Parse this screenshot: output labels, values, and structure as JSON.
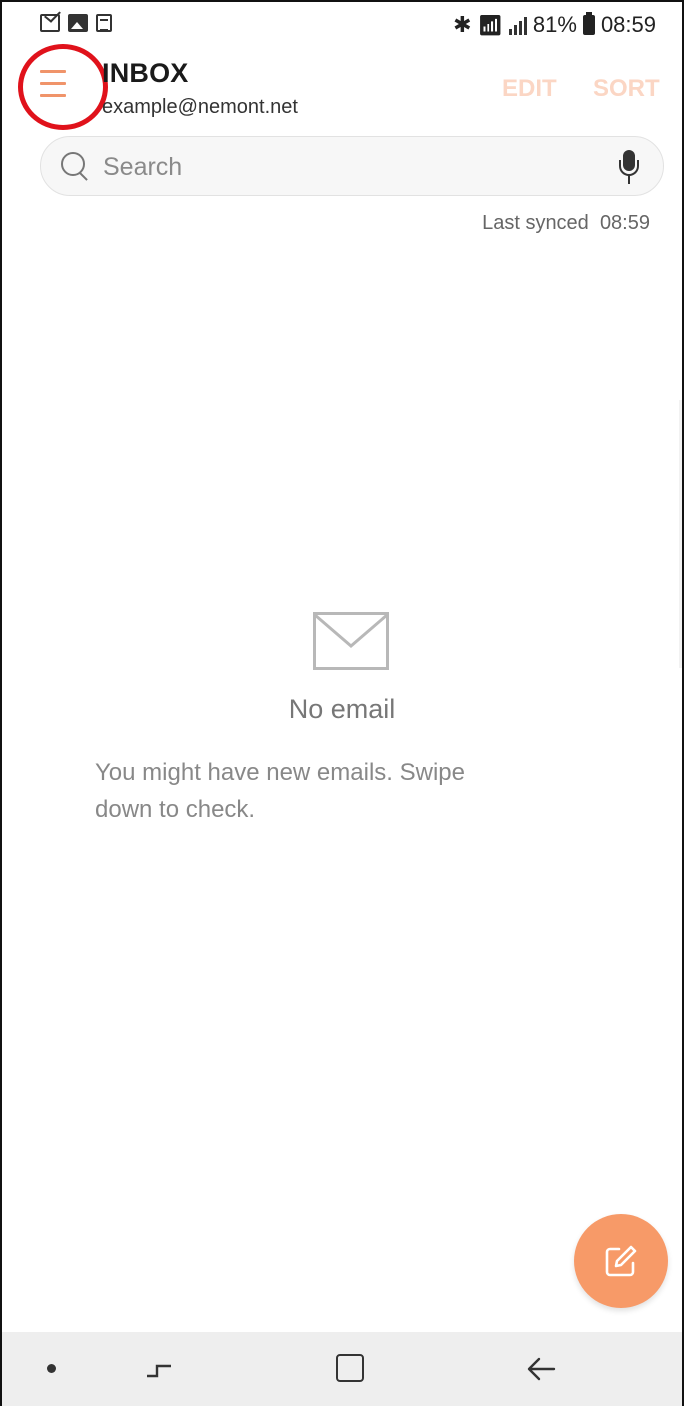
{
  "status_bar": {
    "battery_percent": "81%",
    "time": "08:59",
    "left_icons": [
      "mail-icon",
      "gallery-icon",
      "document-icon"
    ],
    "right_icons": [
      "bluetooth-icon",
      "wifi-icon",
      "signal-icon",
      "battery-icon"
    ]
  },
  "header": {
    "title": "INBOX",
    "account": "example@nemont.net",
    "edit_label": "EDIT",
    "sort_label": "SORT",
    "menu_icon": "hamburger-menu-icon"
  },
  "search": {
    "placeholder": "Search",
    "mic_icon": "microphone-icon"
  },
  "sync": {
    "label": "Last synced",
    "time": "08:59"
  },
  "empty_state": {
    "title": "No email",
    "message": "You might have new emails. Swipe down to check.",
    "icon": "envelope-icon"
  },
  "fab": {
    "icon": "compose-icon"
  },
  "nav_bar": {
    "icons": [
      "dot-icon",
      "recents-icon",
      "home-icon",
      "back-icon"
    ]
  },
  "colors": {
    "accent": "#f79a68",
    "accent_light": "#fbd6c4",
    "annotation": "#e0121b"
  }
}
